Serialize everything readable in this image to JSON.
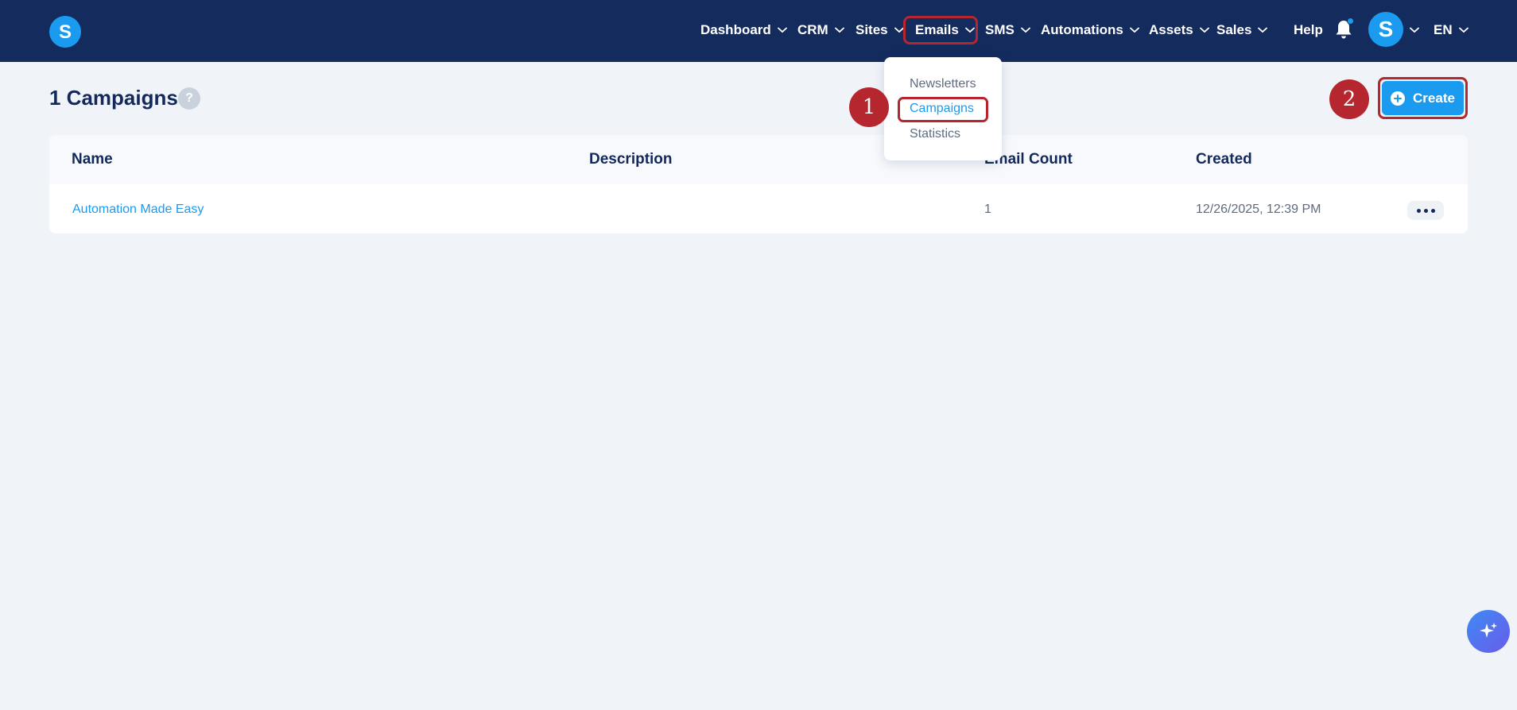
{
  "nav": {
    "dashboard": "Dashboard",
    "crm": "CRM",
    "sites": "Sites",
    "emails": "Emails",
    "sms": "SMS",
    "automations": "Automations",
    "assets": "Assets",
    "sales": "Sales",
    "help": "Help",
    "language": "EN"
  },
  "logo": {
    "letter": "S"
  },
  "avatar": {
    "letter": "S"
  },
  "page": {
    "title": "1 Campaigns",
    "help_badge": "?"
  },
  "create_button": {
    "label": "Create"
  },
  "table": {
    "headers": [
      "Name",
      "Description",
      "Email Count",
      "Created"
    ],
    "rows": [
      {
        "name": "Automation Made Easy",
        "description": "",
        "email_count": "1",
        "created": "12/26/2025, 12:39 PM"
      }
    ]
  },
  "emails_menu": {
    "items": [
      "Newsletters",
      "Campaigns",
      "Statistics"
    ],
    "active": "Campaigns"
  },
  "steps": [
    "1",
    "2"
  ],
  "colors": {
    "nav_bg": "#142b5e",
    "accent": "#1a9bf0",
    "highlight": "#b5262e",
    "page_bg": "#f0f4f9"
  },
  "icons": [
    "chevron-down-icon",
    "bell-icon",
    "plus-circle-icon",
    "more-horizontal-icon",
    "sparkle-icon"
  ]
}
